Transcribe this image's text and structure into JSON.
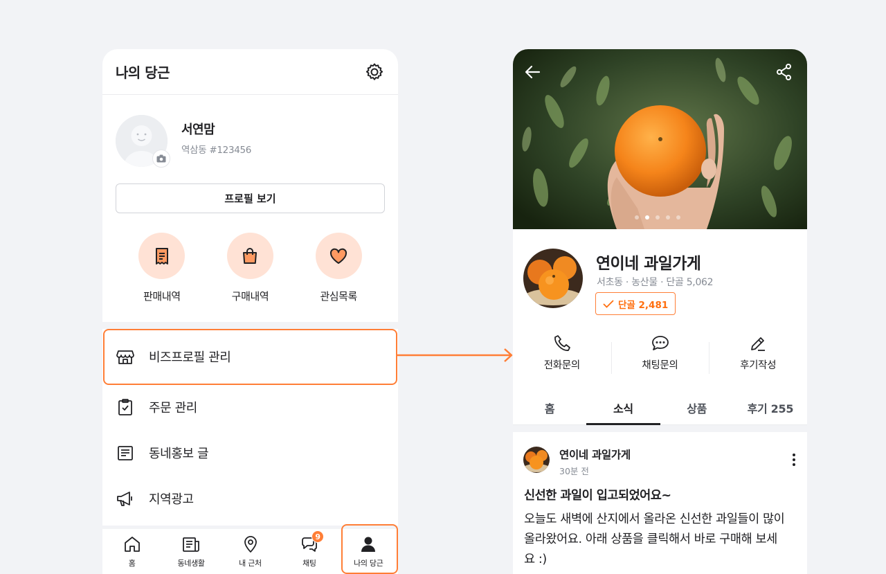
{
  "left": {
    "header": {
      "title": "나의 당근",
      "settings_icon": "gear-icon"
    },
    "profile": {
      "name": "서연맘",
      "sub": "역삼동 #123456",
      "view_button": "프로필 보기"
    },
    "quick": [
      {
        "label": "판매내역",
        "icon": "receipt-icon"
      },
      {
        "label": "구매내역",
        "icon": "shopping-bag-icon"
      },
      {
        "label": "관심목록",
        "icon": "heart-icon"
      }
    ],
    "menu": [
      {
        "label": "비즈프로필 관리",
        "icon": "store-icon"
      },
      {
        "label": "주문 관리",
        "icon": "clipboard-icon"
      },
      {
        "label": "동네홍보 글",
        "icon": "document-icon"
      },
      {
        "label": "지역광고",
        "icon": "megaphone-icon"
      }
    ],
    "tabbar": [
      {
        "label": "홈",
        "icon": "home-icon"
      },
      {
        "label": "동네생활",
        "icon": "news-icon"
      },
      {
        "label": "내 근처",
        "icon": "location-pin-icon"
      },
      {
        "label": "채팅",
        "icon": "chat-icon",
        "badge": "9"
      },
      {
        "label": "나의 당근",
        "icon": "person-icon"
      }
    ],
    "accent": "#ff7e36"
  },
  "right": {
    "store": {
      "name": "연이네 과일가게",
      "meta": "서초동 · 농산물 · 단골 5,062",
      "regulars_badge": "단골 2,481"
    },
    "actions": [
      {
        "label": "전화문의",
        "icon": "phone-icon"
      },
      {
        "label": "채팅문의",
        "icon": "chat-bubbles-icon"
      },
      {
        "label": "후기작성",
        "icon": "pencil-icon"
      }
    ],
    "tabs": [
      "홈",
      "소식",
      "상품",
      "후기 255"
    ],
    "active_tab": "소식",
    "post": {
      "author": "연이네 과일가게",
      "time": "30분 전",
      "title": "신선한 과일이 입고되었어요~",
      "body": "오늘도 새벽에 산지에서 올라온 신선한 과일들이 많이 올라왔어요. 아래 상품을 클릭해서 바로 구매해 보세요 :)"
    },
    "carousel": {
      "count": 5,
      "active": 2
    }
  }
}
